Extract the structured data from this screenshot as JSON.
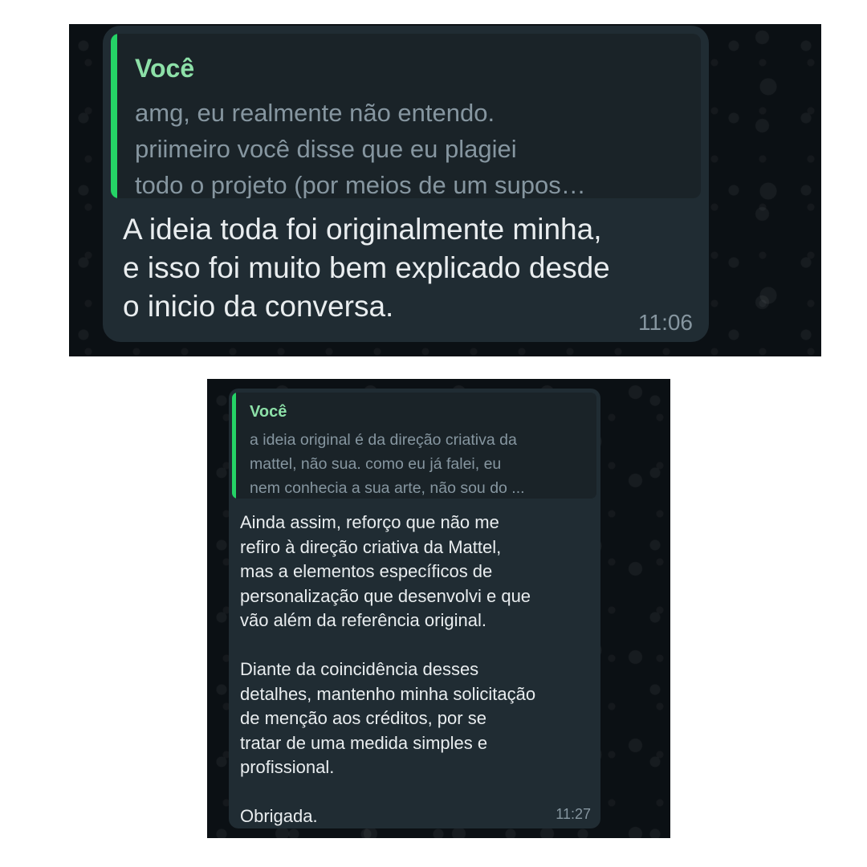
{
  "screenshots": [
    {
      "quote": {
        "sender": "Você",
        "text": "amg, eu realmente não entendo.\npriimeiro você disse que eu plagiei\ntodo o projeto (por meios de um supos…"
      },
      "message": "A ideia toda foi originalmente minha,\ne isso foi muito bem explicado desde\no inicio da conversa.",
      "time": "11:06"
    },
    {
      "quote": {
        "sender": "Você",
        "text": "a ideia original é da direção criativa da\nmattel, não sua. como eu já falei, eu\nnem conhecia a sua arte, não sou do ..."
      },
      "message": "Ainda assim, reforço que não me\nrefiro à direção criativa da Mattel,\nmas a elementos específicos de\npersonalização que desenvolvi e que\nvão além da referência original.\n\nDiante da coincidência desses\ndetalhes, mantenho minha solicitação\nde menção aos créditos, por se\ntratar de uma medida simples e\nprofissional.\n\nObrigada.",
      "time": "11:27"
    }
  ],
  "colors": {
    "background": "#0b1014",
    "bubble": "#202c33",
    "quote_bar": "#25d366",
    "quote_name": "#8de0a8",
    "message_text": "#e9edef",
    "muted_text": "#8696a0"
  }
}
